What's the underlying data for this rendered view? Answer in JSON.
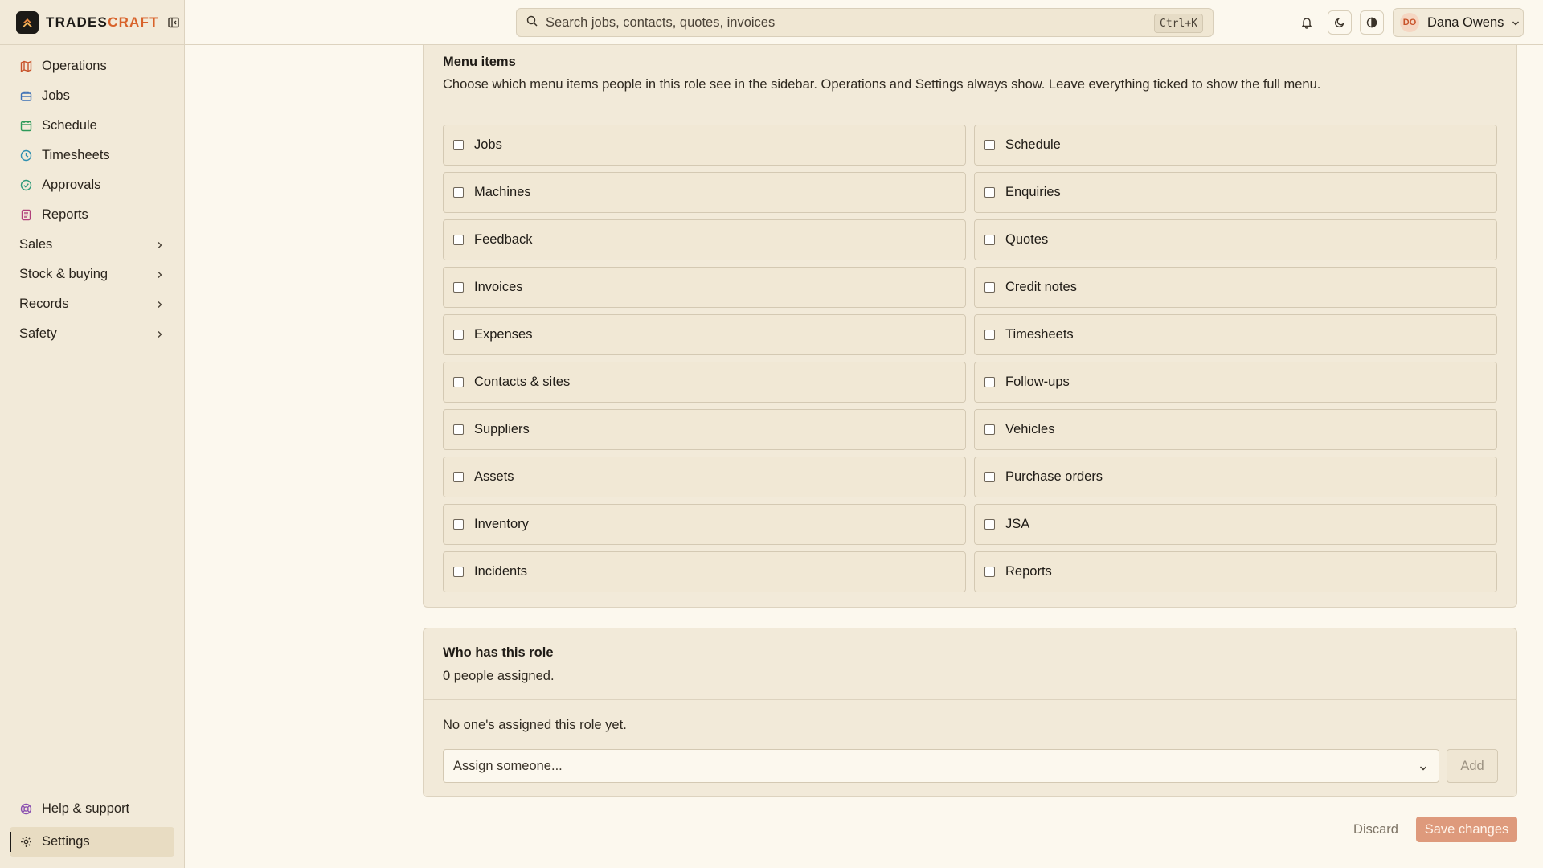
{
  "brand": {
    "name_main": "TRADES",
    "name_accent": "CRAFT"
  },
  "colors": {
    "accent": "#d8622a",
    "background": "#fcf8ee",
    "panel": "#f2ead9",
    "save_button": "#de9a7c"
  },
  "sidebar": {
    "items": [
      {
        "label": "Operations",
        "icon": "map-icon",
        "color": "#c8532a"
      },
      {
        "label": "Jobs",
        "icon": "briefcase-icon",
        "color": "#3b6fb6"
      },
      {
        "label": "Schedule",
        "icon": "calendar-icon",
        "color": "#2e9a5a"
      },
      {
        "label": "Timesheets",
        "icon": "clock-icon",
        "color": "#2f8fb0"
      },
      {
        "label": "Approvals",
        "icon": "check-circle-icon",
        "color": "#2e9a7a"
      },
      {
        "label": "Reports",
        "icon": "report-icon",
        "color": "#b0407a"
      }
    ],
    "groups": [
      {
        "label": "Sales"
      },
      {
        "label": "Stock & buying"
      },
      {
        "label": "Records"
      },
      {
        "label": "Safety"
      }
    ],
    "bottom": [
      {
        "label": "Help & support",
        "icon": "lifebuoy-icon"
      },
      {
        "label": "Settings",
        "icon": "gear-icon"
      }
    ]
  },
  "topbar": {
    "search_placeholder": "Search jobs, contacts, quotes, invoices",
    "search_shortcut": "Ctrl+K",
    "user_initials": "DO",
    "user_name": "Dana Owens"
  },
  "menu_items": {
    "title": "Menu items",
    "description": "Choose which menu items people in this role see in the sidebar. Operations and Settings always show. Leave everything ticked to show the full menu.",
    "options": [
      {
        "label": "Jobs",
        "checked": false
      },
      {
        "label": "Schedule",
        "checked": false
      },
      {
        "label": "Machines",
        "checked": false
      },
      {
        "label": "Enquiries",
        "checked": false
      },
      {
        "label": "Feedback",
        "checked": false
      },
      {
        "label": "Quotes",
        "checked": false
      },
      {
        "label": "Invoices",
        "checked": false
      },
      {
        "label": "Credit notes",
        "checked": false
      },
      {
        "label": "Expenses",
        "checked": false
      },
      {
        "label": "Timesheets",
        "checked": false
      },
      {
        "label": "Contacts & sites",
        "checked": false
      },
      {
        "label": "Follow-ups",
        "checked": false
      },
      {
        "label": "Suppliers",
        "checked": false
      },
      {
        "label": "Vehicles",
        "checked": false
      },
      {
        "label": "Assets",
        "checked": false
      },
      {
        "label": "Purchase orders",
        "checked": false
      },
      {
        "label": "Inventory",
        "checked": false
      },
      {
        "label": "JSA",
        "checked": false
      },
      {
        "label": "Incidents",
        "checked": false
      },
      {
        "label": "Reports",
        "checked": false
      }
    ]
  },
  "who": {
    "title": "Who has this role",
    "count_text": "0 people assigned.",
    "empty_text": "No one's assigned this role yet.",
    "assign_placeholder": "Assign someone...",
    "add_label": "Add"
  },
  "actions": {
    "discard": "Discard",
    "save": "Save changes"
  }
}
